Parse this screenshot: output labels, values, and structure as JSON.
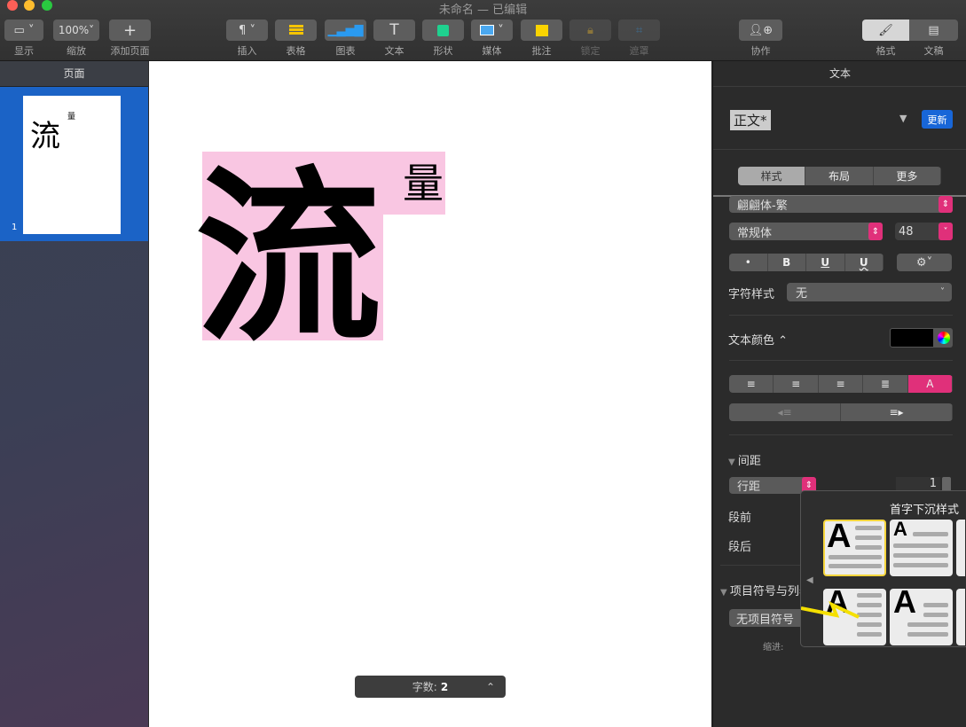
{
  "window": {
    "title": "未命名 — 已编辑"
  },
  "toolbar": {
    "left": [
      {
        "label": "显示",
        "icon": "sidebar-icon"
      },
      {
        "label": "缩放",
        "value": "100%"
      },
      {
        "label": "添加页面",
        "icon": "plus-icon"
      }
    ],
    "insert": [
      {
        "label": "插入",
        "icon": "paragraph-icon"
      },
      {
        "label": "表格",
        "icon": "table-icon"
      },
      {
        "label": "图表",
        "icon": "chart-icon"
      },
      {
        "label": "文本",
        "icon": "text-icon"
      },
      {
        "label": "形状",
        "icon": "shape-icon"
      },
      {
        "label": "媒体",
        "icon": "media-icon"
      },
      {
        "label": "批注",
        "icon": "comment-icon"
      },
      {
        "label": "锁定",
        "icon": "lock-icon"
      },
      {
        "label": "遮罩",
        "icon": "mask-icon"
      }
    ],
    "collab": {
      "label": "协作"
    },
    "format": {
      "label": "格式"
    },
    "document": {
      "label": "文稿"
    }
  },
  "sidebar": {
    "header": "页面",
    "pages": [
      {
        "number": "1",
        "thumb_big": "流",
        "thumb_small": "量"
      }
    ]
  },
  "canvas": {
    "big_char": "流",
    "small_char": "量",
    "highlight_color": "#f9c6e2"
  },
  "status": {
    "word_count_label": "字数:",
    "word_count": "2"
  },
  "panel": {
    "header": "文本",
    "paragraph_style": "正文*",
    "update_button": "更新",
    "tabs": [
      "样式",
      "布局",
      "更多"
    ],
    "font_family": "翩翩体-繁",
    "font_style": "常规体",
    "font_size": "48",
    "format_buttons": [
      "•",
      "B",
      "U",
      "U"
    ],
    "char_style_label": "字符样式",
    "char_style_value": "无",
    "text_color_label": "文本颜色",
    "text_color": "#000000",
    "spacing_label": "间距",
    "line_spacing_mode": "行距",
    "line_spacing_value": "1",
    "before_label": "段前",
    "after_label": "段后",
    "bullets_label": "项目符号与列表",
    "bullets_value": "无项目符号",
    "indent_label": "缩进:",
    "accent": "#e0307a"
  },
  "popover": {
    "title": "首字下沉样式",
    "tile_letter": "A"
  }
}
